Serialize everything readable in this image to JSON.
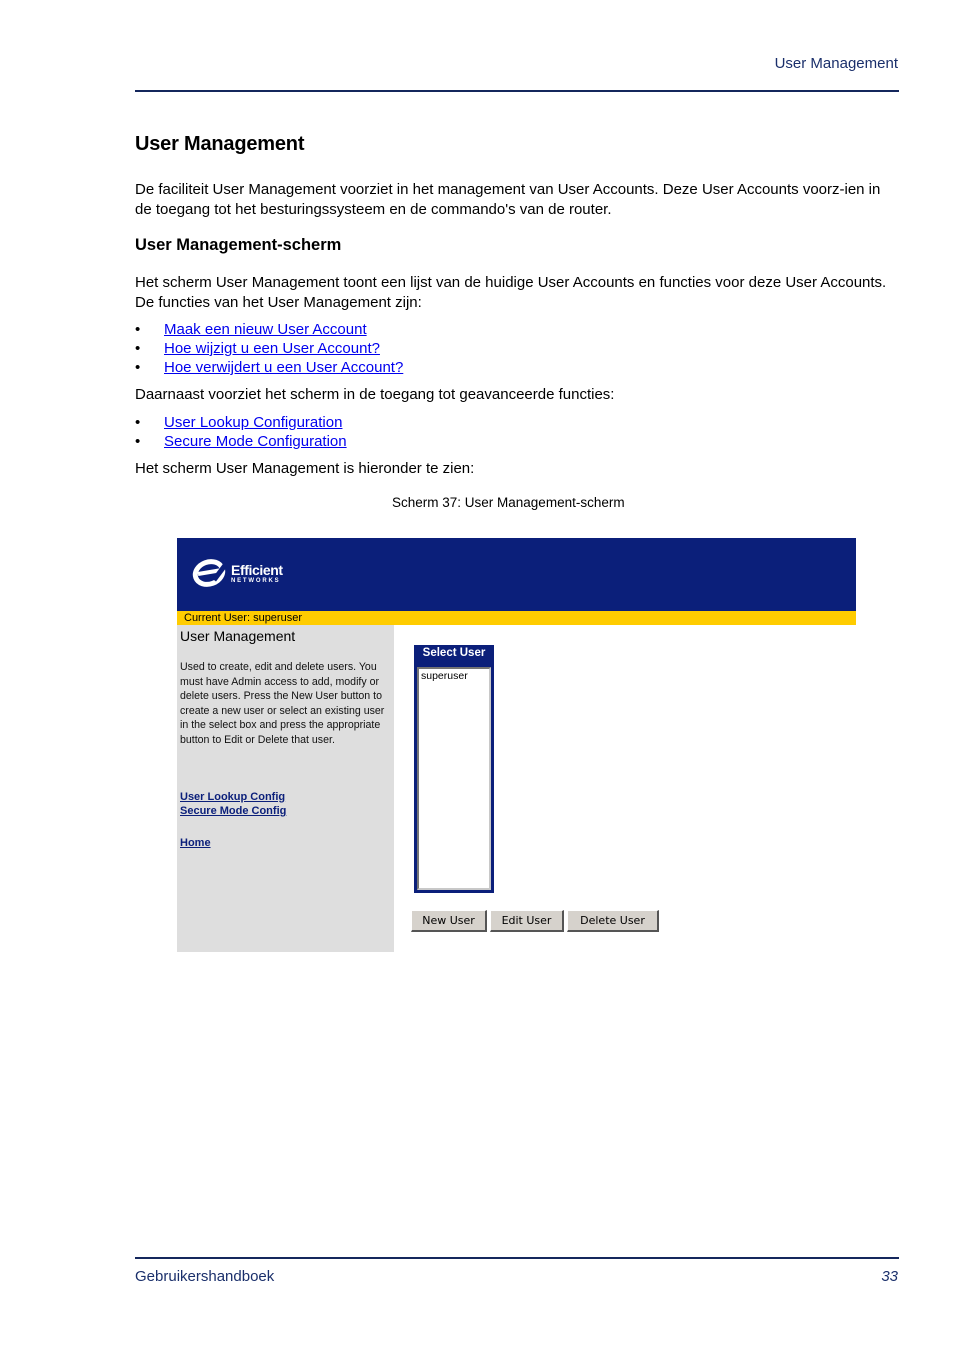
{
  "header": {
    "running_head": "User Management"
  },
  "content": {
    "title": "User Management",
    "intro": "De faciliteit User Management voorziet in het management van User Accounts. Deze User Accounts voorz-ien in de toegang tot het besturingssysteem en de commando's van de router.",
    "subtitle": "User Management-scherm",
    "para2": "Het scherm User Management toont een lijst van de huidige User Accounts en functies voor deze User Accounts. De functies van het User Management zijn:",
    "bullet": "•",
    "functions": [
      {
        "label": "Maak een nieuw User Account"
      },
      {
        "label": "Hoe wijzigt u een User Account?"
      },
      {
        "label": "Hoe verwijdert u een User Account?"
      }
    ],
    "para3": "Daarnaast voorziet het scherm in de toegang tot geavanceerde functies:",
    "advanced": [
      {
        "label": "User Lookup Configuration"
      },
      {
        "label": "Secure Mode Configuration"
      }
    ],
    "para4": "Het scherm User Management is hieronder te zien:",
    "caption": "Scherm 37: User Management-scherm"
  },
  "screen": {
    "brand": {
      "line1": "Efficient",
      "line2": "NETWORKS"
    },
    "current_user": "Current User: superuser",
    "sidebar": {
      "title": "User Management",
      "description": "Used to create, edit and delete users. You must have Admin access to add, modify or delete users. Press the New User button to create a new user or select an existing user in the select box and press the appropriate button to Edit or Delete that user.",
      "links": [
        "User Lookup Config",
        "Secure Mode Config",
        "Home"
      ]
    },
    "select_user": {
      "title": "Select User",
      "options": [
        "superuser"
      ]
    },
    "buttons": {
      "new": "New User",
      "edit": "Edit User",
      "delete": "Delete User"
    },
    "colors": {
      "banner": "#0b1f7a",
      "userbar": "#ffcc00",
      "sidebar": "#dedede"
    }
  },
  "footer": {
    "left": "Gebruikershandboek",
    "page": "33"
  }
}
